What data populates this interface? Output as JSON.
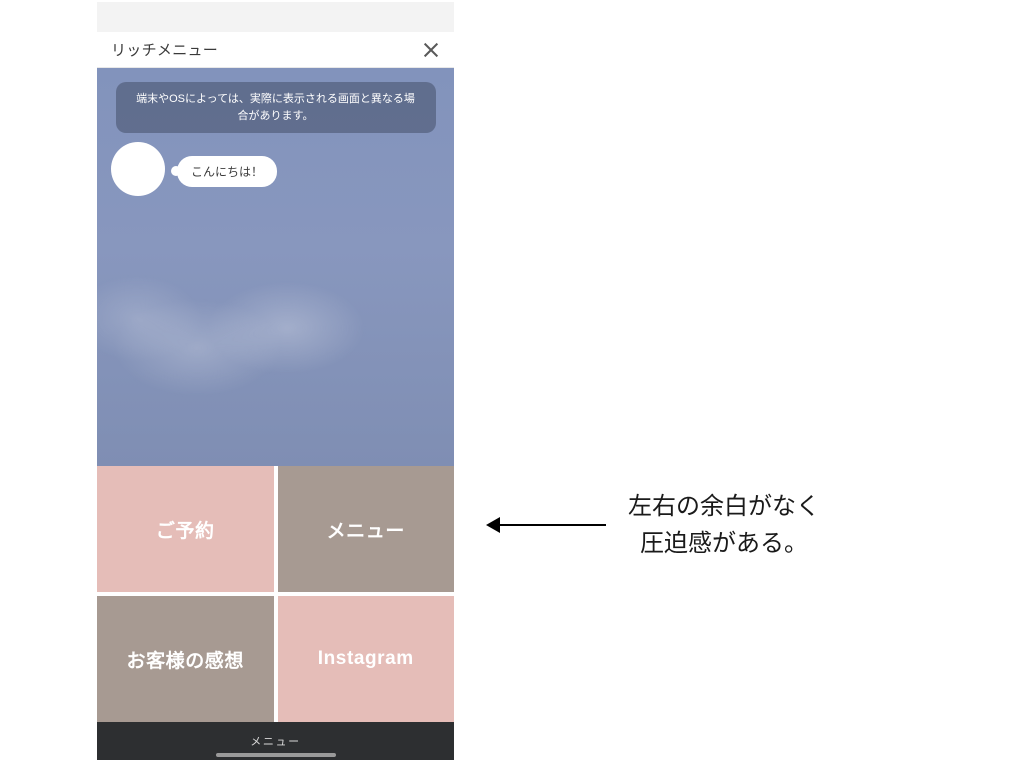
{
  "phone": {
    "header_title": "リッチメニュー",
    "notice_text": "端末やOSによっては、実際に表示される画面と異なる場合があります。",
    "greeting_bubble": "こんにちは！",
    "richmenu": {
      "tiles": [
        {
          "label": "ご予約",
          "style": "pink"
        },
        {
          "label": "メニュー",
          "style": "taupe"
        },
        {
          "label": "お客様の感想",
          "style": "taupe"
        },
        {
          "label": "Instagram",
          "style": "pink"
        }
      ]
    },
    "bottom_bar_label": "メニュー"
  },
  "annotation": {
    "line1": "左右の余白がなく",
    "line2": "圧迫感がある。"
  },
  "colors": {
    "pink": "#e5bdb8",
    "taupe": "#a79a92",
    "chat_bg": "#8293bc",
    "bottom_bar": "#2d2f31"
  }
}
